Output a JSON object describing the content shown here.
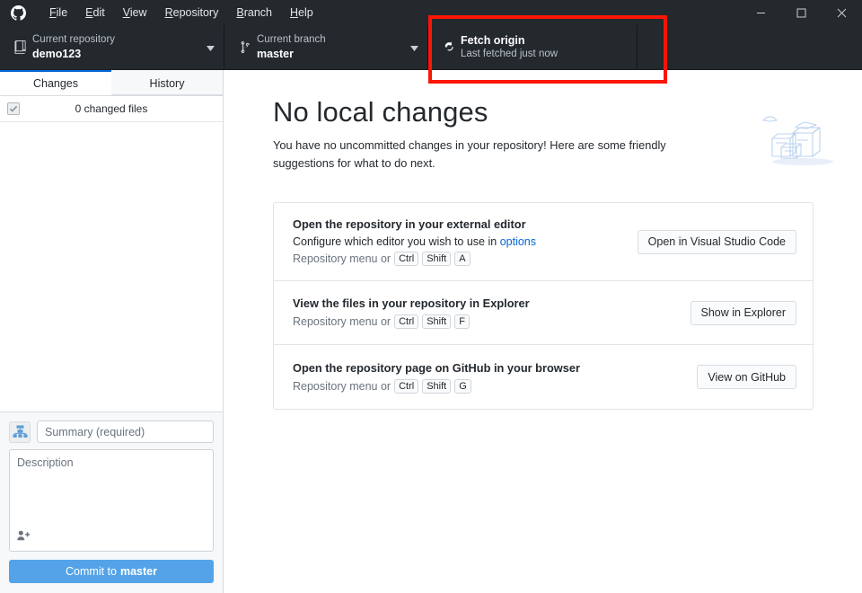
{
  "window": {
    "app_logo": "github-octocat-icon",
    "menu": [
      {
        "label": "File",
        "accel": "F"
      },
      {
        "label": "Edit",
        "accel": "E"
      },
      {
        "label": "View",
        "accel": "V"
      },
      {
        "label": "Repository",
        "accel": "R"
      },
      {
        "label": "Branch",
        "accel": "B"
      },
      {
        "label": "Help",
        "accel": "H"
      }
    ],
    "controls": {
      "minimize": "minimize-icon",
      "maximize": "maximize-icon",
      "close": "close-icon"
    }
  },
  "toolbar": {
    "repository": {
      "icon": "repo-book-icon",
      "label": "Current repository",
      "value": "demo123",
      "caret": "chevron-down-icon"
    },
    "branch": {
      "icon": "git-branch-icon",
      "label": "Current branch",
      "value": "master",
      "caret": "chevron-down-icon"
    },
    "fetch": {
      "icon": "sync-refresh-icon",
      "label": "Fetch origin",
      "sub": "Last fetched just now"
    }
  },
  "sidebar": {
    "tabs": [
      {
        "label": "Changes",
        "active": true
      },
      {
        "label": "History",
        "active": false
      }
    ],
    "changed_files": {
      "checkbox": "checked-checkbox-icon",
      "label": "0 changed files"
    },
    "commit": {
      "avatar": "git-network-avatar-icon",
      "summary_placeholder": "Summary (required)",
      "summary_value": "",
      "description_placeholder": "Description",
      "description_value": "",
      "coauthor_icon": "add-person-icon",
      "button_prefix": "Commit to",
      "button_branch": "master"
    }
  },
  "main": {
    "title": "No local changes",
    "subtitle": "You have no uncommitted changes in your repository! Here are some friendly suggestions for what to do next.",
    "illustration": "boxes-and-birds-illustration",
    "suggestions": [
      {
        "title": "Open the repository in your external editor",
        "description_prefix": "Configure which editor you wish to use in ",
        "description_link": "options",
        "hint_prefix": "Repository menu or",
        "keys": [
          "Ctrl",
          "Shift",
          "A"
        ],
        "button": "Open in Visual Studio Code"
      },
      {
        "title": "View the files in your repository in Explorer",
        "description_prefix": "",
        "description_link": "",
        "hint_prefix": "Repository menu or",
        "keys": [
          "Ctrl",
          "Shift",
          "F"
        ],
        "button": "Show in Explorer"
      },
      {
        "title": "Open the repository page on GitHub in your browser",
        "description_prefix": "",
        "description_link": "",
        "hint_prefix": "Repository menu or",
        "keys": [
          "Ctrl",
          "Shift",
          "G"
        ],
        "button": "View on GitHub"
      }
    ]
  },
  "annotation": {
    "target": "fetch-origin-button",
    "color": "#fb1505"
  },
  "colors": {
    "toolbar_bg": "#24292e",
    "accent_blue": "#0366d6",
    "commit_button": "#54a3e8",
    "annotation_red": "#fb1505"
  }
}
